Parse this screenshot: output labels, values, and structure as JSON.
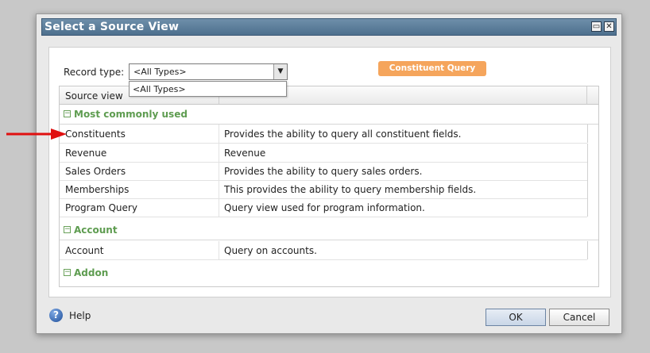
{
  "dialog": {
    "title": "Select a Source View",
    "minimize_glyph": "▭",
    "close_glyph": "✕"
  },
  "filter": {
    "record_type_label": "Record type:",
    "selected": "<All Types>",
    "dropdown_option": "<All Types>",
    "faq_button": "Constituent Query FAQs"
  },
  "grid": {
    "column_header": "Source view",
    "groups": [
      {
        "label": "Most commonly used",
        "rows": [
          {
            "name": "Constituents",
            "description": "Provides the ability to query all constituent fields."
          },
          {
            "name": "Revenue",
            "description": "Revenue"
          },
          {
            "name": "Sales Orders",
            "description": "Provides the ability to query sales orders."
          },
          {
            "name": "Memberships",
            "description": "This provides the ability to query membership fields."
          },
          {
            "name": "Program Query",
            "description": "Query view used for program information."
          }
        ]
      },
      {
        "label": "Account",
        "rows": [
          {
            "name": "Account",
            "description": "Query on accounts."
          }
        ]
      },
      {
        "label": "Addon",
        "rows": []
      }
    ],
    "group_toggle_glyph": "−"
  },
  "footer": {
    "help_label": "Help",
    "help_glyph": "?",
    "ok_label": "OK",
    "cancel_label": "Cancel"
  },
  "colors": {
    "group_green": "#5e9c50",
    "faq_orange": "#f5a55c",
    "title_blue": "#4d6f8d",
    "annotation_red": "#e01010"
  }
}
